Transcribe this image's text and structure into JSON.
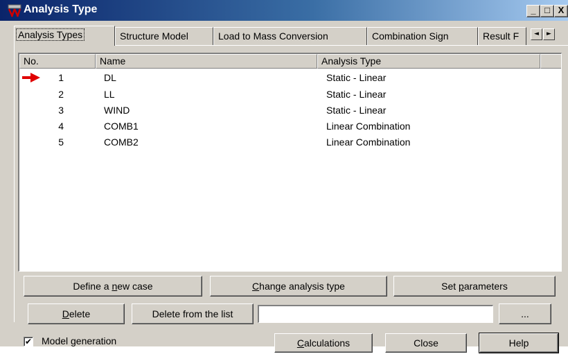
{
  "window": {
    "title": "Analysis Type",
    "controls": {
      "minimize": "_",
      "maximize": "□",
      "close": "X"
    }
  },
  "tabs": [
    {
      "label": "Analysis Types",
      "active": true
    },
    {
      "label": "Structure Model",
      "active": false
    },
    {
      "label": "Load to Mass Conversion",
      "active": false
    },
    {
      "label": "Combination Sign",
      "active": false
    },
    {
      "label": "Result F",
      "active": false
    }
  ],
  "tab_scroll": {
    "left": "◄",
    "right": "►"
  },
  "list": {
    "columns": [
      "No.",
      "Name",
      "Analysis Type"
    ],
    "rows": [
      {
        "no": "1",
        "name": "DL",
        "type": "Static - Linear",
        "selected_marker": true
      },
      {
        "no": "2",
        "name": "LL",
        "type": "Static - Linear",
        "selected_marker": false
      },
      {
        "no": "3",
        "name": "WIND",
        "type": "Static - Linear",
        "selected_marker": false
      },
      {
        "no": "4",
        "name": "COMB1",
        "type": "Linear Combination",
        "selected_marker": false
      },
      {
        "no": "5",
        "name": "COMB2",
        "type": "Linear Combination",
        "selected_marker": false
      }
    ]
  },
  "buttons": {
    "define_pre": "Define a ",
    "define_ul": "n",
    "define_post": "ew case",
    "change_ul": "C",
    "change_post": "hange analysis type",
    "setparams_pre": "Set ",
    "setparams_ul": "p",
    "setparams_post": "arameters",
    "delete_ul": "D",
    "delete_post": "elete",
    "delete_from_list": "Delete from the list",
    "ellipsis": "...",
    "calc_ul": "C",
    "calc_post": "alculations",
    "close": "Close",
    "help": "Help"
  },
  "text_field": {
    "value": ""
  },
  "model_generation": {
    "label": "Model generation",
    "checked": true,
    "mark": "✔"
  },
  "colors": {
    "marker_arrow": "#e00000",
    "title_start": "#0a246a",
    "title_end": "#a6caf0",
    "face": "#d4d0c8"
  }
}
